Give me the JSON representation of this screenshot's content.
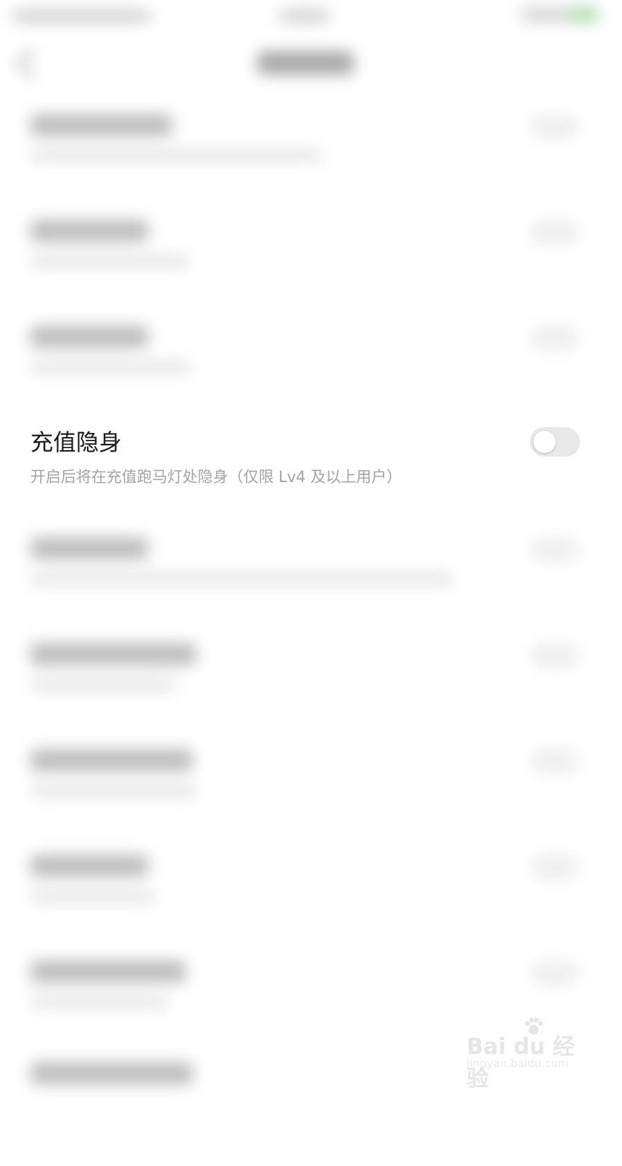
{
  "focused_setting": {
    "title": "充值隐身",
    "description": "开启后将在充值跑马灯处隐身（仅限 Lv4 及以上用户）",
    "toggle_on": false
  },
  "watermark": {
    "brand": "Bai du 经验",
    "url": "jingyan.baidu.com"
  },
  "colors": {
    "toggle_off_track": "#e9e9e9",
    "title_text": "#1b1b1b",
    "description_text": "#a3a3a3",
    "status_accent": "#9bd498"
  }
}
